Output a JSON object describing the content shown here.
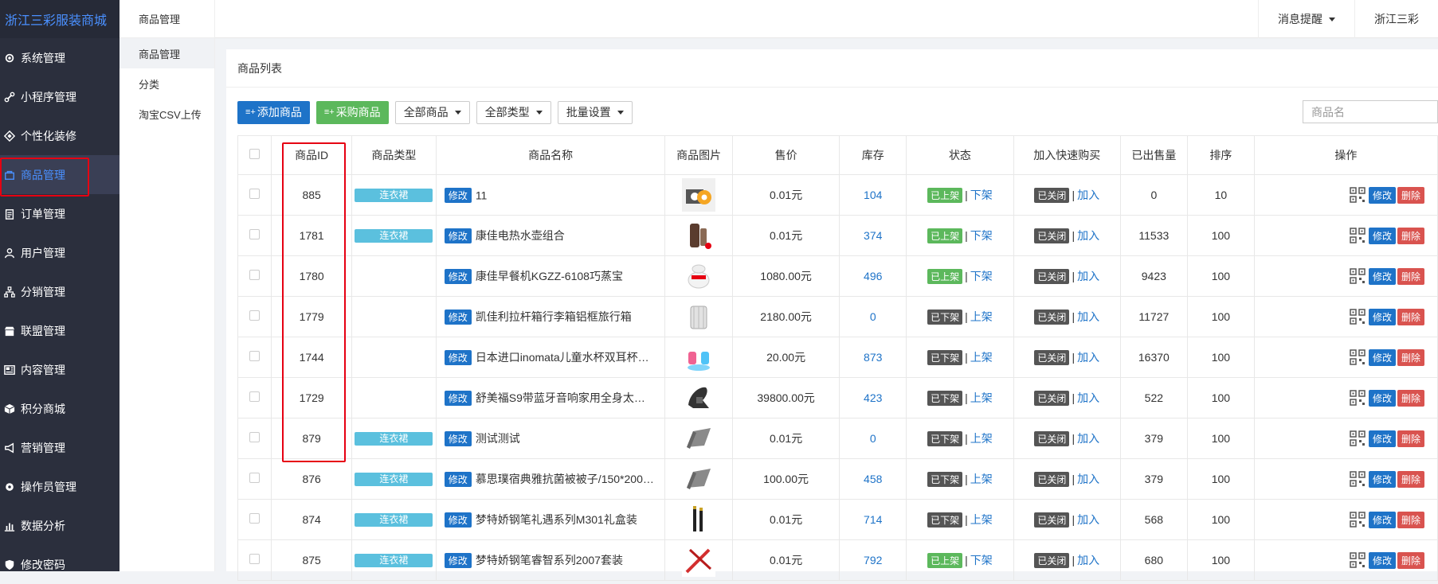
{
  "brand": "浙江三彩服装商城",
  "sidebar": {
    "items": [
      {
        "label": "系统管理",
        "icon": "gear-icon"
      },
      {
        "label": "小程序管理",
        "icon": "link-icon"
      },
      {
        "label": "个性化装修",
        "icon": "diamond-icon"
      },
      {
        "label": "商品管理",
        "icon": "bag-icon",
        "active": true
      },
      {
        "label": "订单管理",
        "icon": "clipboard-icon"
      },
      {
        "label": "用户管理",
        "icon": "user-icon"
      },
      {
        "label": "分销管理",
        "icon": "network-icon"
      },
      {
        "label": "联盟管理",
        "icon": "store-icon"
      },
      {
        "label": "内容管理",
        "icon": "newspaper-icon"
      },
      {
        "label": "积分商城",
        "icon": "cube-icon"
      },
      {
        "label": "营销管理",
        "icon": "megaphone-icon"
      },
      {
        "label": "操作员管理",
        "icon": "cog-icon"
      },
      {
        "label": "数据分析",
        "icon": "bar-chart-icon"
      },
      {
        "label": "修改密码",
        "icon": "shield-icon"
      }
    ]
  },
  "subside": {
    "title": "商品管理",
    "items": [
      "商品管理",
      "分类",
      "淘宝CSV上传"
    ]
  },
  "topbar": {
    "notice": "消息提醒",
    "user": "浙江三彩"
  },
  "panel": {
    "title": "商品列表",
    "toolbar": {
      "add": "添加商品",
      "purchase": "采购商品",
      "all_goods": "全部商品",
      "all_types": "全部类型",
      "batch": "批量设置",
      "search_placeholder": "商品名"
    }
  },
  "table": {
    "headers": [
      "商品ID",
      "商品类型",
      "商品名称",
      "商品图片",
      "售价",
      "库存",
      "状态",
      "加入快速购买",
      "已出售量",
      "排序",
      "操作"
    ],
    "edit_label": "修改",
    "delete_label": "删除",
    "join_label": "加入",
    "off_shelf_action": "下架",
    "on_shelf_action": "上架",
    "rows": [
      {
        "id": "885",
        "type": "连衣裙",
        "name": "11",
        "image": "gear-image",
        "price": "0.01元",
        "stock": "104",
        "state": "已上架",
        "state_on": true,
        "quick": "已关闭",
        "sold": "0",
        "sort": "10"
      },
      {
        "id": "1781",
        "type": "连衣裙",
        "name": "康佳电热水壶组合",
        "image": "kettle-image",
        "price": "0.01元",
        "stock": "374",
        "state": "已上架",
        "state_on": true,
        "quick": "已关闭",
        "sold": "11533",
        "sort": "100"
      },
      {
        "id": "1780",
        "type": "",
        "name": "康佳早餐机KGZZ-6108巧蒸宝",
        "image": "steamer-image",
        "price": "1080.00元",
        "stock": "496",
        "state": "已上架",
        "state_on": true,
        "quick": "已关闭",
        "sold": "9423",
        "sort": "100"
      },
      {
        "id": "1779",
        "type": "",
        "name": "凯佳利拉杆箱行李箱铝框旅行箱",
        "image": "suitcase-image",
        "price": "2180.00元",
        "stock": "0",
        "state": "已下架",
        "state_on": false,
        "quick": "已关闭",
        "sold": "11727",
        "sort": "100"
      },
      {
        "id": "1744",
        "type": "",
        "name": "日本进口inomata儿童水杯双耳杯…",
        "image": "cups-image",
        "price": "20.00元",
        "stock": "873",
        "state": "已下架",
        "state_on": false,
        "quick": "已关闭",
        "sold": "16370",
        "sort": "100"
      },
      {
        "id": "1729",
        "type": "",
        "name": "舒美福S9带蓝牙音响家用全身太…",
        "image": "massage-chair-image",
        "price": "39800.00元",
        "stock": "423",
        "state": "已下架",
        "state_on": false,
        "quick": "已关闭",
        "sold": "522",
        "sort": "100"
      },
      {
        "id": "879",
        "type": "连衣裙",
        "name": "测试测试",
        "image": "fabric-image",
        "price": "0.01元",
        "stock": "0",
        "state": "已下架",
        "state_on": false,
        "quick": "已关闭",
        "sold": "379",
        "sort": "100"
      },
      {
        "id": "876",
        "type": "连衣裙",
        "name": "慕思璞宿典雅抗菌被被子/150*200…",
        "image": "fabric-image",
        "price": "100.00元",
        "stock": "458",
        "state": "已下架",
        "state_on": false,
        "quick": "已关闭",
        "sold": "379",
        "sort": "100"
      },
      {
        "id": "874",
        "type": "连衣裙",
        "name": "梦特娇钢笔礼遇系列M301礼盒装",
        "image": "pens-image",
        "price": "0.01元",
        "stock": "714",
        "state": "已下架",
        "state_on": false,
        "quick": "已关闭",
        "sold": "568",
        "sort": "100"
      },
      {
        "id": "875",
        "type": "连衣裙",
        "name": "梦特娇钢笔睿智系列2007套装",
        "image": "pen-red-image",
        "price": "0.01元",
        "stock": "792",
        "state": "已上架",
        "state_on": true,
        "quick": "已关闭",
        "sold": "680",
        "sort": "100"
      }
    ]
  }
}
